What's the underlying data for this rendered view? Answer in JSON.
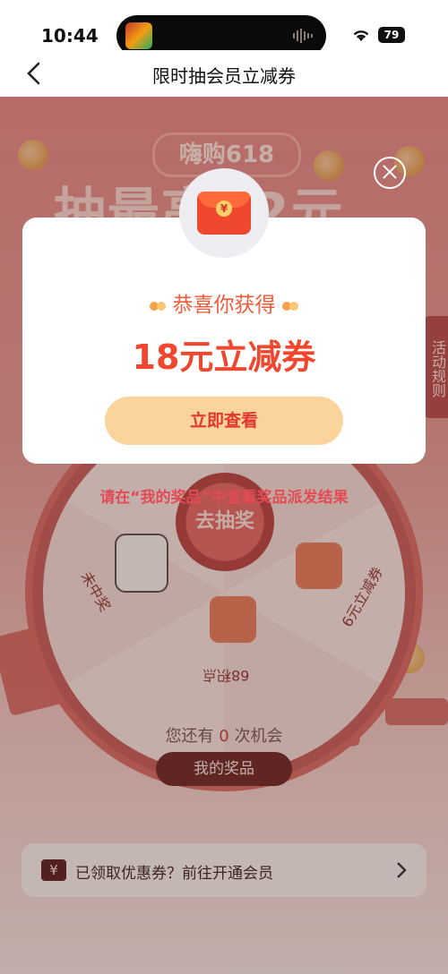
{
  "status_bar": {
    "time": "10:44",
    "battery": "79"
  },
  "nav": {
    "title": "限时抽会员立减券"
  },
  "background": {
    "promo_badge": "嗨购618",
    "promo_title": "抽最高62元",
    "rules_tab": "活动规则",
    "wheel_center": "去抽奖",
    "wheel_labels": {
      "left": "未中奖",
      "bottom": "68积点",
      "right": "6元立减券"
    },
    "notice": "请在“我的奖品”中查看奖品派发结果",
    "chances_prefix": "您还有",
    "chances_count": "0",
    "chances_suffix": "次机会",
    "my_prizes_button": "我的奖品",
    "member_bar_text": "已领取优惠券？前往开通会员",
    "member_bar_icon": "¥"
  },
  "modal": {
    "icon_symbol": "¥",
    "congrats_text": "恭喜你获得",
    "prize_text": "18元立减券",
    "view_button": "立即查看"
  }
}
